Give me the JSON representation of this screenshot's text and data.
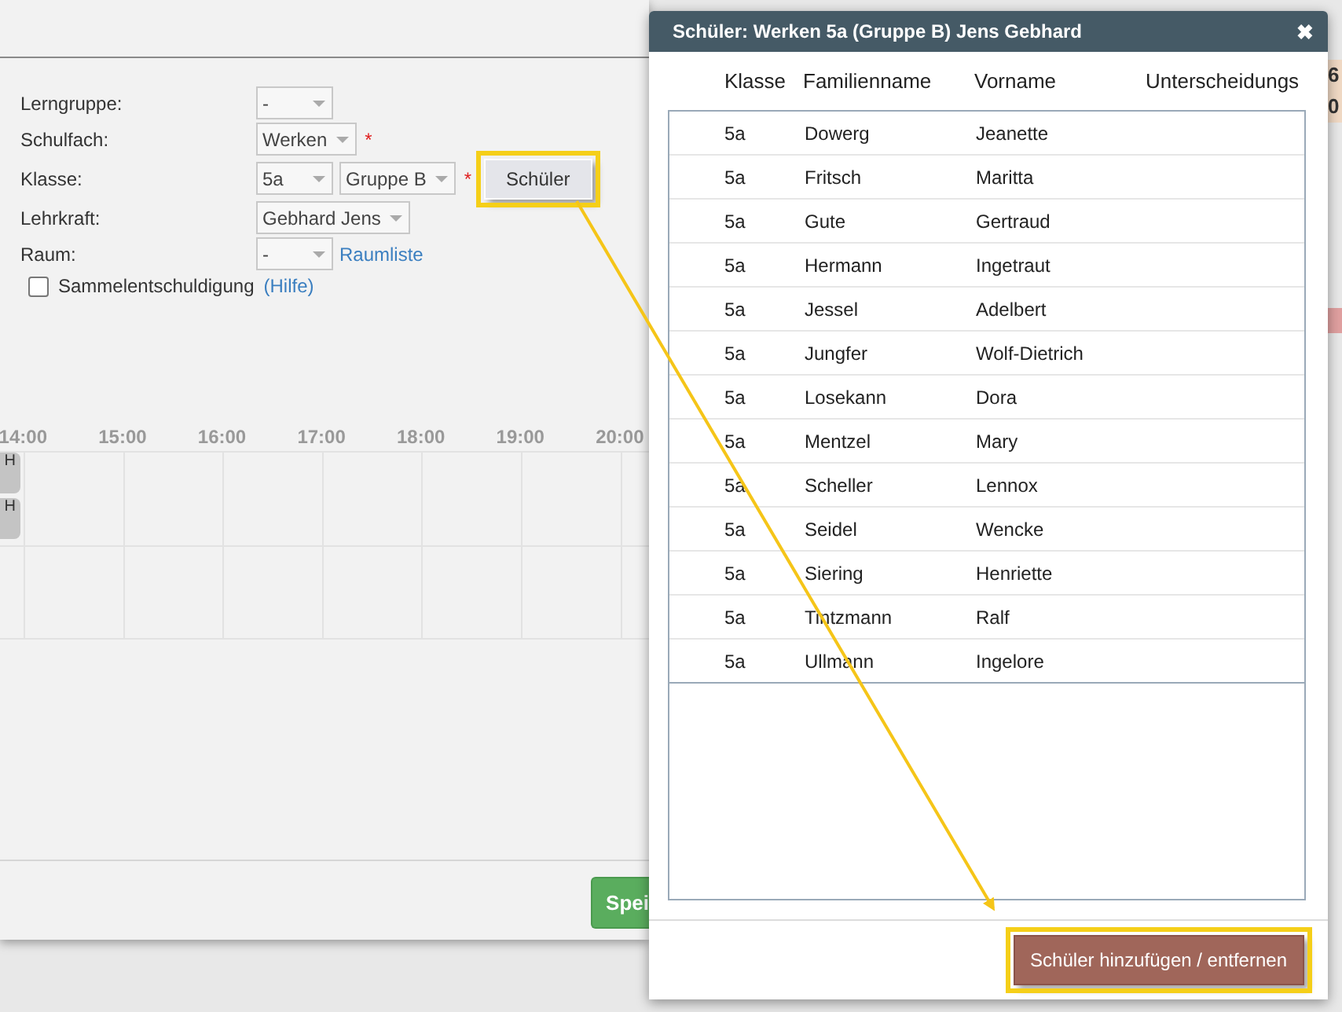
{
  "form": {
    "fields": [
      {
        "label": "Lerngruppe:",
        "selects": [
          "-"
        ]
      },
      {
        "label": "Schulfach:",
        "selects": [
          "Werken"
        ],
        "required_mark": "*"
      },
      {
        "label": "Klasse:",
        "selects": [
          "5a",
          "Gruppe B"
        ],
        "required_mark": "*",
        "button": {
          "label": "Schüler",
          "highlighted": true
        }
      },
      {
        "label": "Lehrkraft:",
        "selects": [
          "Gebhard Jens"
        ]
      },
      {
        "label": "Raum:",
        "selects": [
          "-"
        ],
        "link": "Raumliste"
      }
    ],
    "checkbox": {
      "label": "Sammelentschuldigung",
      "checked": false,
      "link": "(Hilfe)"
    }
  },
  "timeline": {
    "hours": [
      "14:00",
      "15:00",
      "16:00",
      "17:00",
      "18:00",
      "19:00",
      "20:00"
    ],
    "events": [
      {
        "label": "H"
      },
      {
        "label": "H"
      }
    ]
  },
  "save_button": "Spei",
  "background": {
    "fragments": [
      "6",
      "0"
    ]
  },
  "modal": {
    "title": "Schüler: Werken 5a (Gruppe B) Jens Gebhard",
    "close": "✖",
    "columns": [
      "Klasse",
      "Familienname",
      "Vorname",
      "Unterscheidungs"
    ],
    "rows": [
      [
        "5a",
        "Dowerg",
        "Jeanette"
      ],
      [
        "5a",
        "Fritsch",
        "Maritta"
      ],
      [
        "5a",
        "Gute",
        "Gertraud"
      ],
      [
        "5a",
        "Hermann",
        "Ingetraut"
      ],
      [
        "5a",
        "Jessel",
        "Adelbert"
      ],
      [
        "5a",
        "Jungfer",
        "Wolf-Dietrich"
      ],
      [
        "5a",
        "Losekann",
        "Dora"
      ],
      [
        "5a",
        "Mentzel",
        "Mary"
      ],
      [
        "5a",
        "Scheller",
        "Lennox"
      ],
      [
        "5a",
        "Seidel",
        "Wencke"
      ],
      [
        "5a",
        "Siering",
        "Henriette"
      ],
      [
        "5a",
        "Tintzmann",
        "Ralf"
      ],
      [
        "5a",
        "Ullmann",
        "Ingelore"
      ]
    ],
    "button": {
      "label": "Schüler hinzufügen / entfernen",
      "highlighted": true
    }
  }
}
